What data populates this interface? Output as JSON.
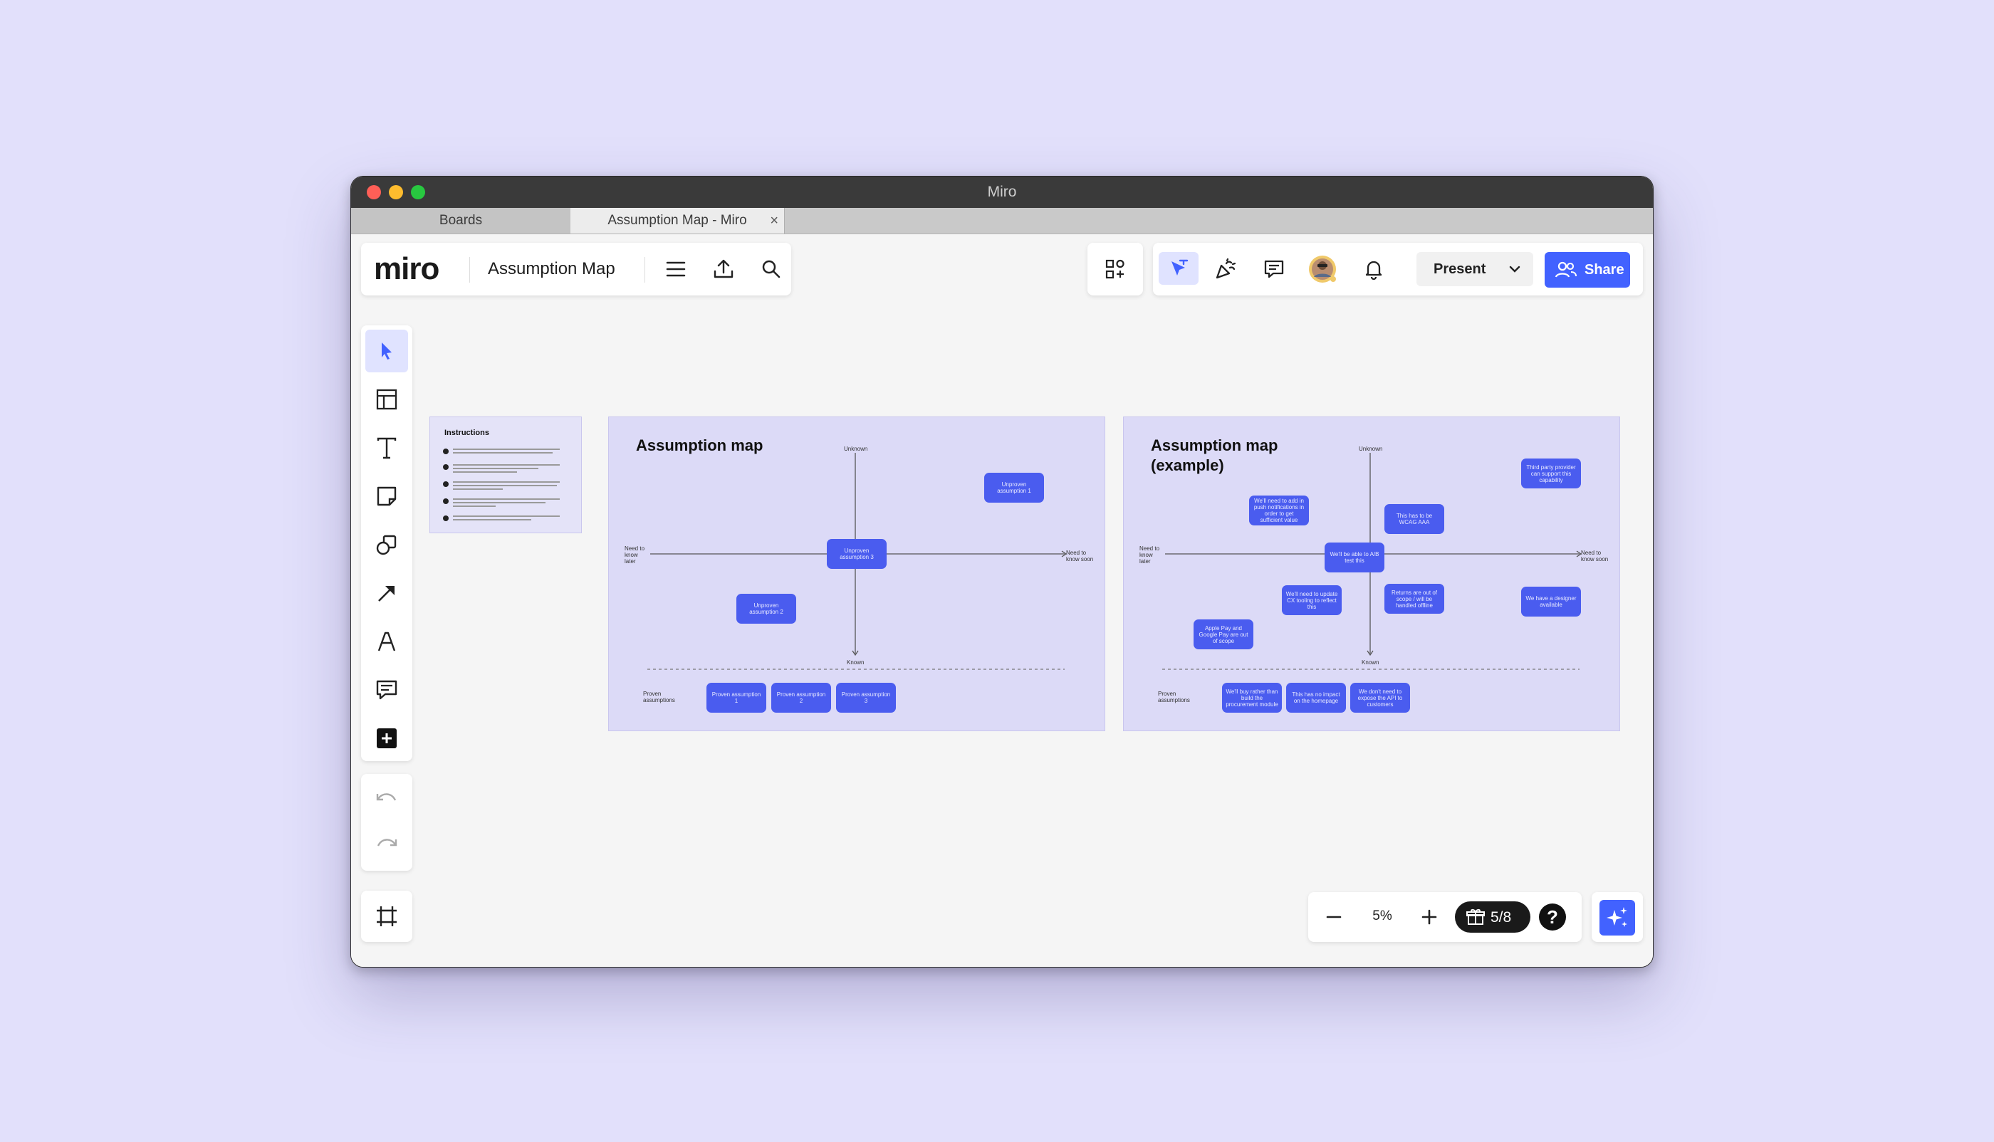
{
  "window": {
    "title": "Miro"
  },
  "tabs": [
    {
      "label": "Boards"
    },
    {
      "label": "Assumption Map - Miro"
    }
  ],
  "toolbar": {
    "logo": "miro",
    "board_name": "Assumption Map",
    "present_label": "Present",
    "share_label": "Share"
  },
  "zoom": {
    "value": "5%",
    "frames_label": "5/8",
    "help": "?"
  },
  "instructions": {
    "title": "Instructions",
    "item_count_shown": 5
  },
  "map1": {
    "title": "Assumption map",
    "unknown": "Unknown",
    "known": "Known",
    "left": "Need to know later",
    "right": "Need to know soon",
    "proven": "Proven assumptions",
    "stickies": [
      "Unproven assumption 1",
      "Unproven assumption 3",
      "Unproven assumption 2"
    ],
    "proven_stickies": [
      "Proven assumption 1",
      "Proven assumption 2",
      "Proven assumption 3"
    ]
  },
  "map2": {
    "title": "Assumption map (example)",
    "unknown": "Unknown",
    "known": "Known",
    "left": "Need to know later",
    "right": "Need to know soon",
    "proven": "Proven assumptions",
    "stickies": [
      "Third party provider can support this capability",
      "We'll need to add in push notifications in order to get sufficient value",
      "This has to be WCAG AAA",
      "We'll be able to A/B test this",
      "We'll need to update CX tooling to reflect this",
      "Returns are out of scope / will be handled offline",
      "We have a designer available",
      "Apple Pay and Google Pay are out of scope"
    ],
    "proven_stickies": [
      "We'll buy rather than build the procurement module",
      "This has no impact on the homepage",
      "We don't need to expose the API to customers"
    ]
  },
  "colors": {
    "accent": "#4262ff",
    "sticky": "#4a5cef",
    "frame": "#dcdaf7",
    "background": "#e2e0fb"
  }
}
